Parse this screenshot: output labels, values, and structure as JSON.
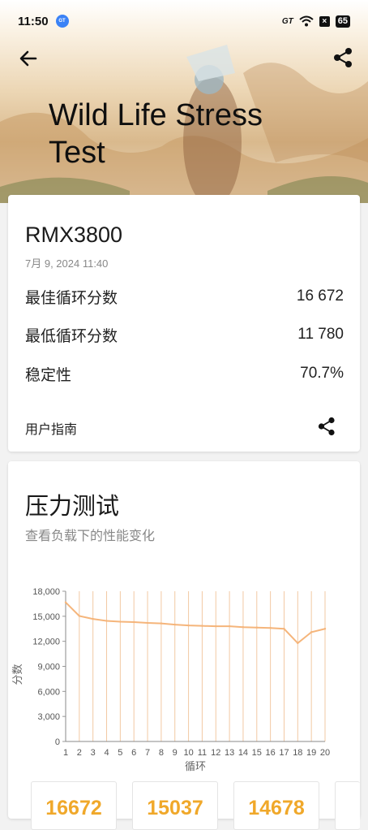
{
  "status_bar": {
    "time": "11:50",
    "gt_app": "GT",
    "network_label": "GT",
    "battery": "65"
  },
  "header": {
    "title": "Wild Life Stress Test"
  },
  "summary": {
    "device": "RMX3800",
    "date": "7月 9, 2024 11:40",
    "rows": [
      {
        "label": "最佳循环分数",
        "value": "16 672"
      },
      {
        "label": "最低循环分数",
        "value": "11 780"
      },
      {
        "label": "稳定性",
        "value": "70.7%"
      }
    ],
    "guide_label": "用户指南"
  },
  "stress_section": {
    "title": "压力测试",
    "subtitle": "查看负载下的性能变化"
  },
  "chart_data": {
    "type": "line",
    "xlabel": "循环",
    "ylabel": "分数",
    "x": [
      1,
      2,
      3,
      4,
      5,
      6,
      7,
      8,
      9,
      10,
      11,
      12,
      13,
      14,
      15,
      16,
      17,
      18,
      19,
      20
    ],
    "series": [
      {
        "values": [
          16672,
          15037,
          14678,
          14450,
          14350,
          14300,
          14200,
          14150,
          14000,
          13900,
          13850,
          13800,
          13800,
          13700,
          13650,
          13600,
          13500,
          11780,
          13100,
          13500
        ],
        "color": "#f5b57b"
      }
    ],
    "ylim": [
      0,
      18000
    ],
    "y_ticks": [
      "0",
      "3,000",
      "6,000",
      "9,000",
      "12,000",
      "15,000",
      "18,000"
    ],
    "grid": true
  },
  "loop_scores": [
    "16672",
    "15037",
    "14678"
  ],
  "colors": {
    "accent": "#f0a82a",
    "line": "#f5b57b",
    "grid": "#f2c9a3"
  }
}
